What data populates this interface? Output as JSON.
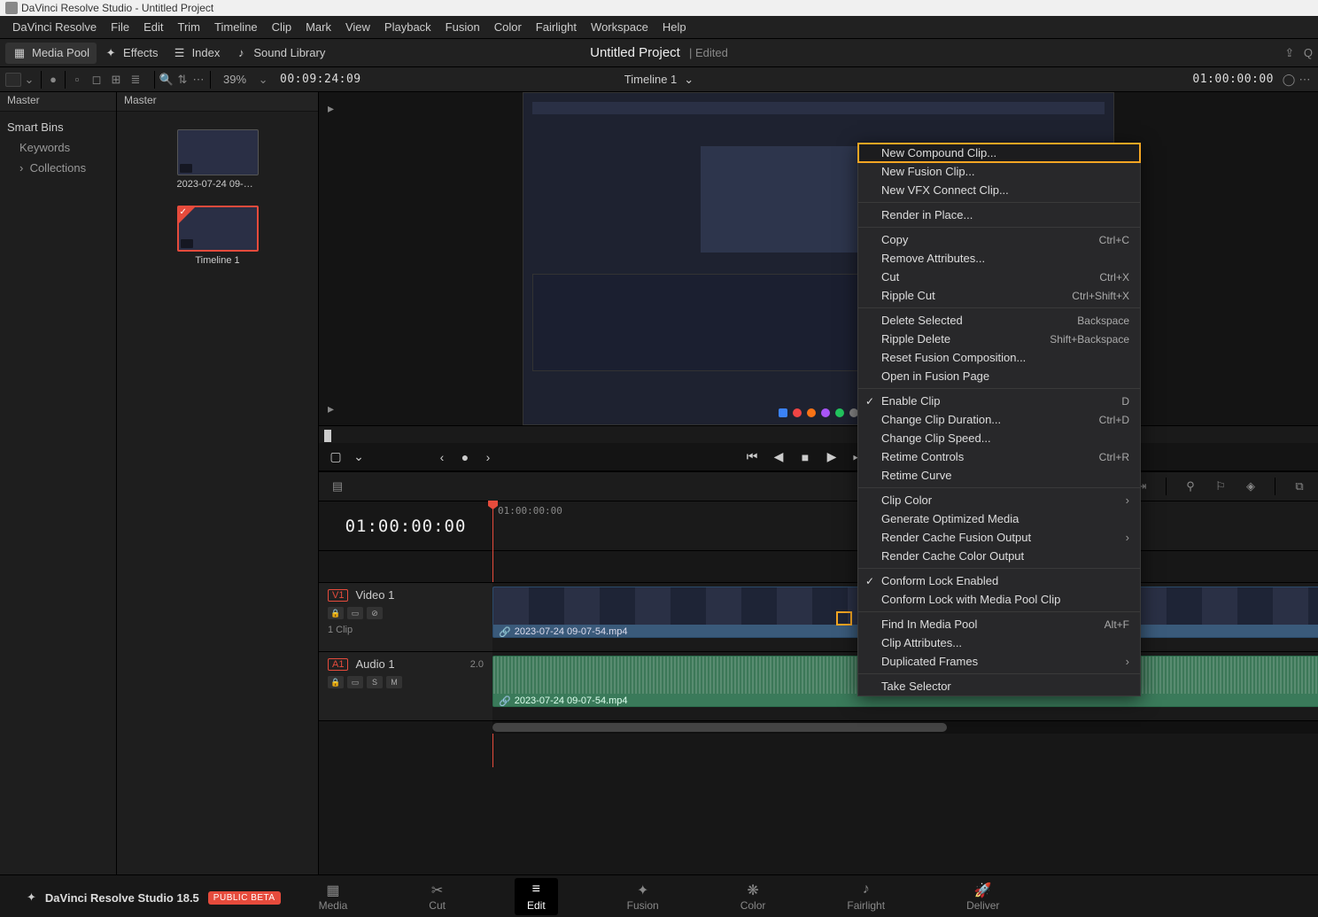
{
  "window": {
    "title": "DaVinci Resolve Studio - Untitled Project"
  },
  "menu": [
    "DaVinci Resolve",
    "File",
    "Edit",
    "Trim",
    "Timeline",
    "Clip",
    "Mark",
    "View",
    "Playback",
    "Fusion",
    "Color",
    "Fairlight",
    "Workspace",
    "Help"
  ],
  "toolbar": {
    "media_pool": "Media Pool",
    "effects": "Effects",
    "index": "Index",
    "sound_lib": "Sound Library",
    "project": "Untitled Project",
    "edited": "Edited",
    "q_label": "Q"
  },
  "option_row": {
    "zoom": "39%",
    "src_tc": "00:09:24:09",
    "timeline_name": "Timeline 1",
    "rec_tc": "01:00:00:00"
  },
  "pool": {
    "left_header": "Master",
    "right_header": "Master",
    "clips": [
      {
        "name": "2023-07-24 09-07-..."
      },
      {
        "name": "Timeline 1"
      }
    ]
  },
  "smart_bins": {
    "title": "Smart Bins",
    "keywords": "Keywords",
    "collections": "Collections"
  },
  "timeline": {
    "tc": "01:00:00:00",
    "ruler_tc0": "01:00:00:00",
    "v1_badge": "V1",
    "v1_name": "Video 1",
    "v1_sub": "1 Clip",
    "a1_badge": "A1",
    "a1_name": "Audio 1",
    "a1_ch": "2.0",
    "clip_v_label": "2023-07-24 09-07-54.mp4",
    "clip_a_label": "2023-07-24 09-07-54.mp4"
  },
  "ctx": {
    "new_compound": "New Compound Clip...",
    "new_fusion": "New Fusion Clip...",
    "new_vfx": "New VFX Connect Clip...",
    "render_in_place": "Render in Place...",
    "copy": "Copy",
    "copy_sc": "Ctrl+C",
    "remove_attr": "Remove Attributes...",
    "cut": "Cut",
    "cut_sc": "Ctrl+X",
    "ripple_cut": "Ripple Cut",
    "ripple_cut_sc": "Ctrl+Shift+X",
    "delete_sel": "Delete Selected",
    "delete_sel_sc": "Backspace",
    "ripple_del": "Ripple Delete",
    "ripple_del_sc": "Shift+Backspace",
    "reset_fusion": "Reset Fusion Composition...",
    "open_fusion": "Open in Fusion Page",
    "enable_clip": "Enable Clip",
    "enable_clip_sc": "D",
    "chg_dur": "Change Clip Duration...",
    "chg_dur_sc": "Ctrl+D",
    "chg_speed": "Change Clip Speed...",
    "retime_ctrl": "Retime Controls",
    "retime_ctrl_sc": "Ctrl+R",
    "retime_curve": "Retime Curve",
    "clip_color": "Clip Color",
    "gen_opt": "Generate Optimized Media",
    "cache_fusion": "Render Cache Fusion Output",
    "cache_color": "Render Cache Color Output",
    "conform_lock": "Conform Lock Enabled",
    "conform_mp": "Conform Lock with Media Pool Clip",
    "find_mp": "Find In Media Pool",
    "find_mp_sc": "Alt+F",
    "clip_attr": "Clip Attributes...",
    "dup_frames": "Duplicated Frames",
    "take_sel": "Take Selector"
  },
  "pages": {
    "media": "Media",
    "cut": "Cut",
    "edit": "Edit",
    "fusion": "Fusion",
    "color": "Color",
    "fairlight": "Fairlight",
    "deliver": "Deliver"
  },
  "footer": {
    "title": "DaVinci Resolve Studio 18.5",
    "beta": "PUBLIC BETA"
  }
}
